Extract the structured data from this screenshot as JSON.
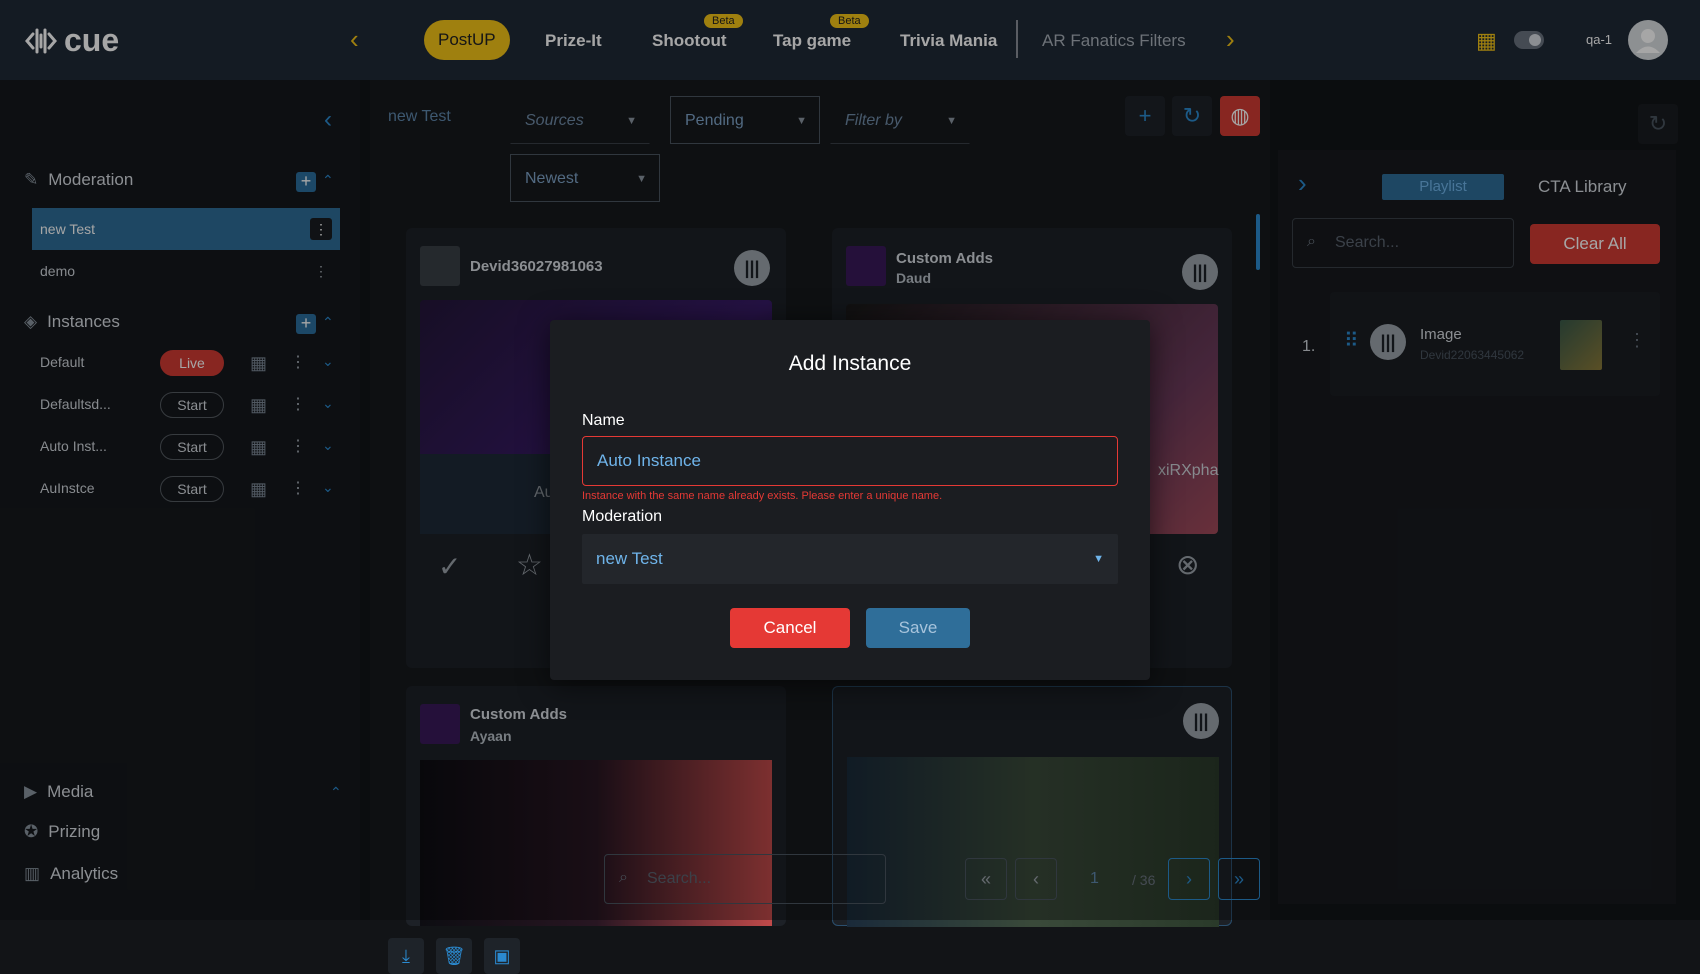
{
  "brand": {
    "name": "cue"
  },
  "topnav": {
    "items": [
      {
        "label": "PostUP"
      },
      {
        "label": "Prize-It"
      },
      {
        "label": "Shootout",
        "badge": "Beta"
      },
      {
        "label": "Tap game",
        "badge": "Beta"
      },
      {
        "label": "Trivia Mania"
      },
      {
        "label": "AR Fanatics Filters"
      }
    ],
    "user": "qa-1"
  },
  "sidebar": {
    "moderation_heading": "Moderation",
    "moderation_items": [
      {
        "label": "new Test"
      },
      {
        "label": "demo"
      }
    ],
    "instances_heading": "Instances",
    "instances": [
      {
        "name": "Default",
        "action": "Live"
      },
      {
        "name": "Defaultsd...",
        "action": "Start"
      },
      {
        "name": "Auto Inst...",
        "action": "Start"
      },
      {
        "name": "AuInstce",
        "action": "Start"
      }
    ],
    "bottom": [
      {
        "label": "Media"
      },
      {
        "label": "Prizing"
      },
      {
        "label": "Analytics"
      }
    ]
  },
  "main": {
    "breadcrumb": "new Test",
    "filters": {
      "sources": "Sources",
      "status": "Pending",
      "filter_by": "Filter by",
      "sort": "Newest"
    },
    "cards": [
      {
        "title": "Devid36027981063",
        "sub": ""
      },
      {
        "title": "Custom Adds",
        "sub": "Daud"
      },
      {
        "title": "Custom Adds",
        "sub": "Ayaan"
      }
    ],
    "card_text_left": "Aut",
    "card_text_right": "xiRXpha",
    "search_placeholder": "Search...",
    "pager": {
      "current": "1",
      "total": "/ 36"
    }
  },
  "right": {
    "tabs": [
      "Playlist",
      "CTA Library"
    ],
    "search_placeholder": "Search...",
    "clear_all": "Clear All",
    "playlist": [
      {
        "index": "1.",
        "title": "Image",
        "subtitle": "Devid22063445062"
      }
    ]
  },
  "modal": {
    "title": "Add Instance",
    "name_label": "Name",
    "name_value": "Auto Instance",
    "error": "Instance with the same name already exists. Please enter a unique name.",
    "moderation_label": "Moderation",
    "moderation_value": "new Test",
    "cancel": "Cancel",
    "save": "Save"
  }
}
